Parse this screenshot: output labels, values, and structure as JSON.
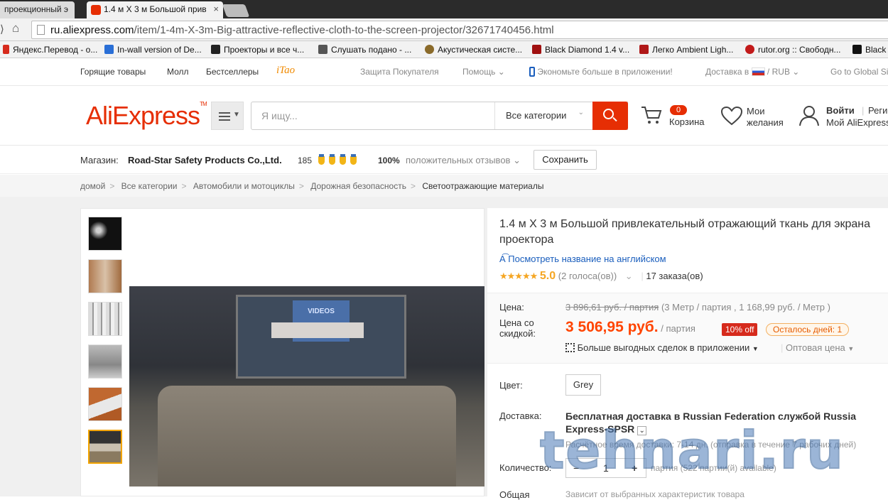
{
  "browser": {
    "tabs": [
      {
        "label": "проекционный э"
      },
      {
        "label": "1.4 м X 3 м Большой прив"
      }
    ],
    "tab_close": "×",
    "url_domain": "ru.aliexpress.com",
    "url_path": "/item/1-4m-X-3m-Big-attractive-reflective-cloth-to-the-screen-projector/32671740456.html",
    "bookmarks": [
      {
        "label": "Яндекс.Перевод - о...",
        "color": "#d62a1c"
      },
      {
        "label": "In-wall version of De...",
        "color": "#2a6fd6"
      },
      {
        "label": "Проекторы и все ч...",
        "color": "#222222"
      },
      {
        "label": "Слушать подано - ...",
        "color": "#555555"
      },
      {
        "label": "Акустическая систе...",
        "color": "#8a6a2a"
      },
      {
        "label": "Black Diamond 1.4 v...",
        "color": "#a01010"
      },
      {
        "label": "Легко Ambient Ligh...",
        "color": "#b01818"
      },
      {
        "label": "rutor.org :: Свободн...",
        "color": "#c21a1a"
      },
      {
        "label": "Black",
        "color": "#111111"
      }
    ]
  },
  "topbar": {
    "hot": "Горящие товары",
    "mall": "Молл",
    "bestsellers": "Бестселлеры",
    "itao": "iTao",
    "protection": "Защита Покупателя",
    "help": "Помощь",
    "app_save": "Экономьте больше в приложении!",
    "ship_to": "Доставка в",
    "currency": "RUB",
    "global": "Go to Global Si"
  },
  "header": {
    "logo": "AliExpress",
    "search_placeholder": "Я ищу...",
    "category": "Все категории",
    "cart_count": "0",
    "cart_label": "Корзина",
    "wish_line1": "Мои",
    "wish_line2": "желания",
    "login": "Войти",
    "register": "Регис",
    "my_ali": "Мой AliExpress"
  },
  "store": {
    "label": "Магазин:",
    "name": "Road-Star Safety Products Co.,Ltd.",
    "score": "185",
    "positive_pct": "100%",
    "positive_label": "положительных отзывов",
    "save": "Сохранить"
  },
  "breadcrumbs": [
    "домой",
    "Все категории",
    "Автомобили и мотоциклы",
    "Дорожная безопасность",
    "Светоотражающие материалы"
  ],
  "product": {
    "title": "1.4 м X 3 м Большой привлекательный отражающий ткань для экрана проектора",
    "translate": "Посмотреть название на английском",
    "rating": "5.0",
    "votes": "(2 голоса(ов))",
    "orders": "17 заказа(ов)",
    "price_label": "Цена:",
    "old_price": "3 896,61 руб. / партия",
    "old_note": "(3 Метр / партия , 1 168,99 руб. / Метр )",
    "disc_label_1": "Цена со",
    "disc_label_2": "скидкой:",
    "price": "3 506,95 руб.",
    "per": "/ партия",
    "off": "10% off",
    "days_left": "Осталось дней: 1",
    "app_deals": "Больше выгодных сделок в приложении",
    "wholesale": "Оптовая цена",
    "color_label": "Цвет:",
    "color_value": "Grey",
    "ship_label": "Доставка:",
    "ship_main": "Бесплатная доставка в Russian Federation службой Russia",
    "ship_carrier": "Express-SPSR",
    "ship_time": "Расчётное время доставки: 7-14 дн. (отправка в течение 7 рабочих дней)",
    "qty_label": "Количество:",
    "qty_minus": "−",
    "qty_value": "1",
    "qty_plus": "+",
    "qty_avail": "партия (522 партии(й) available)",
    "total_label": "Общая",
    "total_note": "Зависит от выбранных характеристик товара"
  },
  "image_overlay_text": "VIDEOS",
  "watermark": "tehnari.ru"
}
